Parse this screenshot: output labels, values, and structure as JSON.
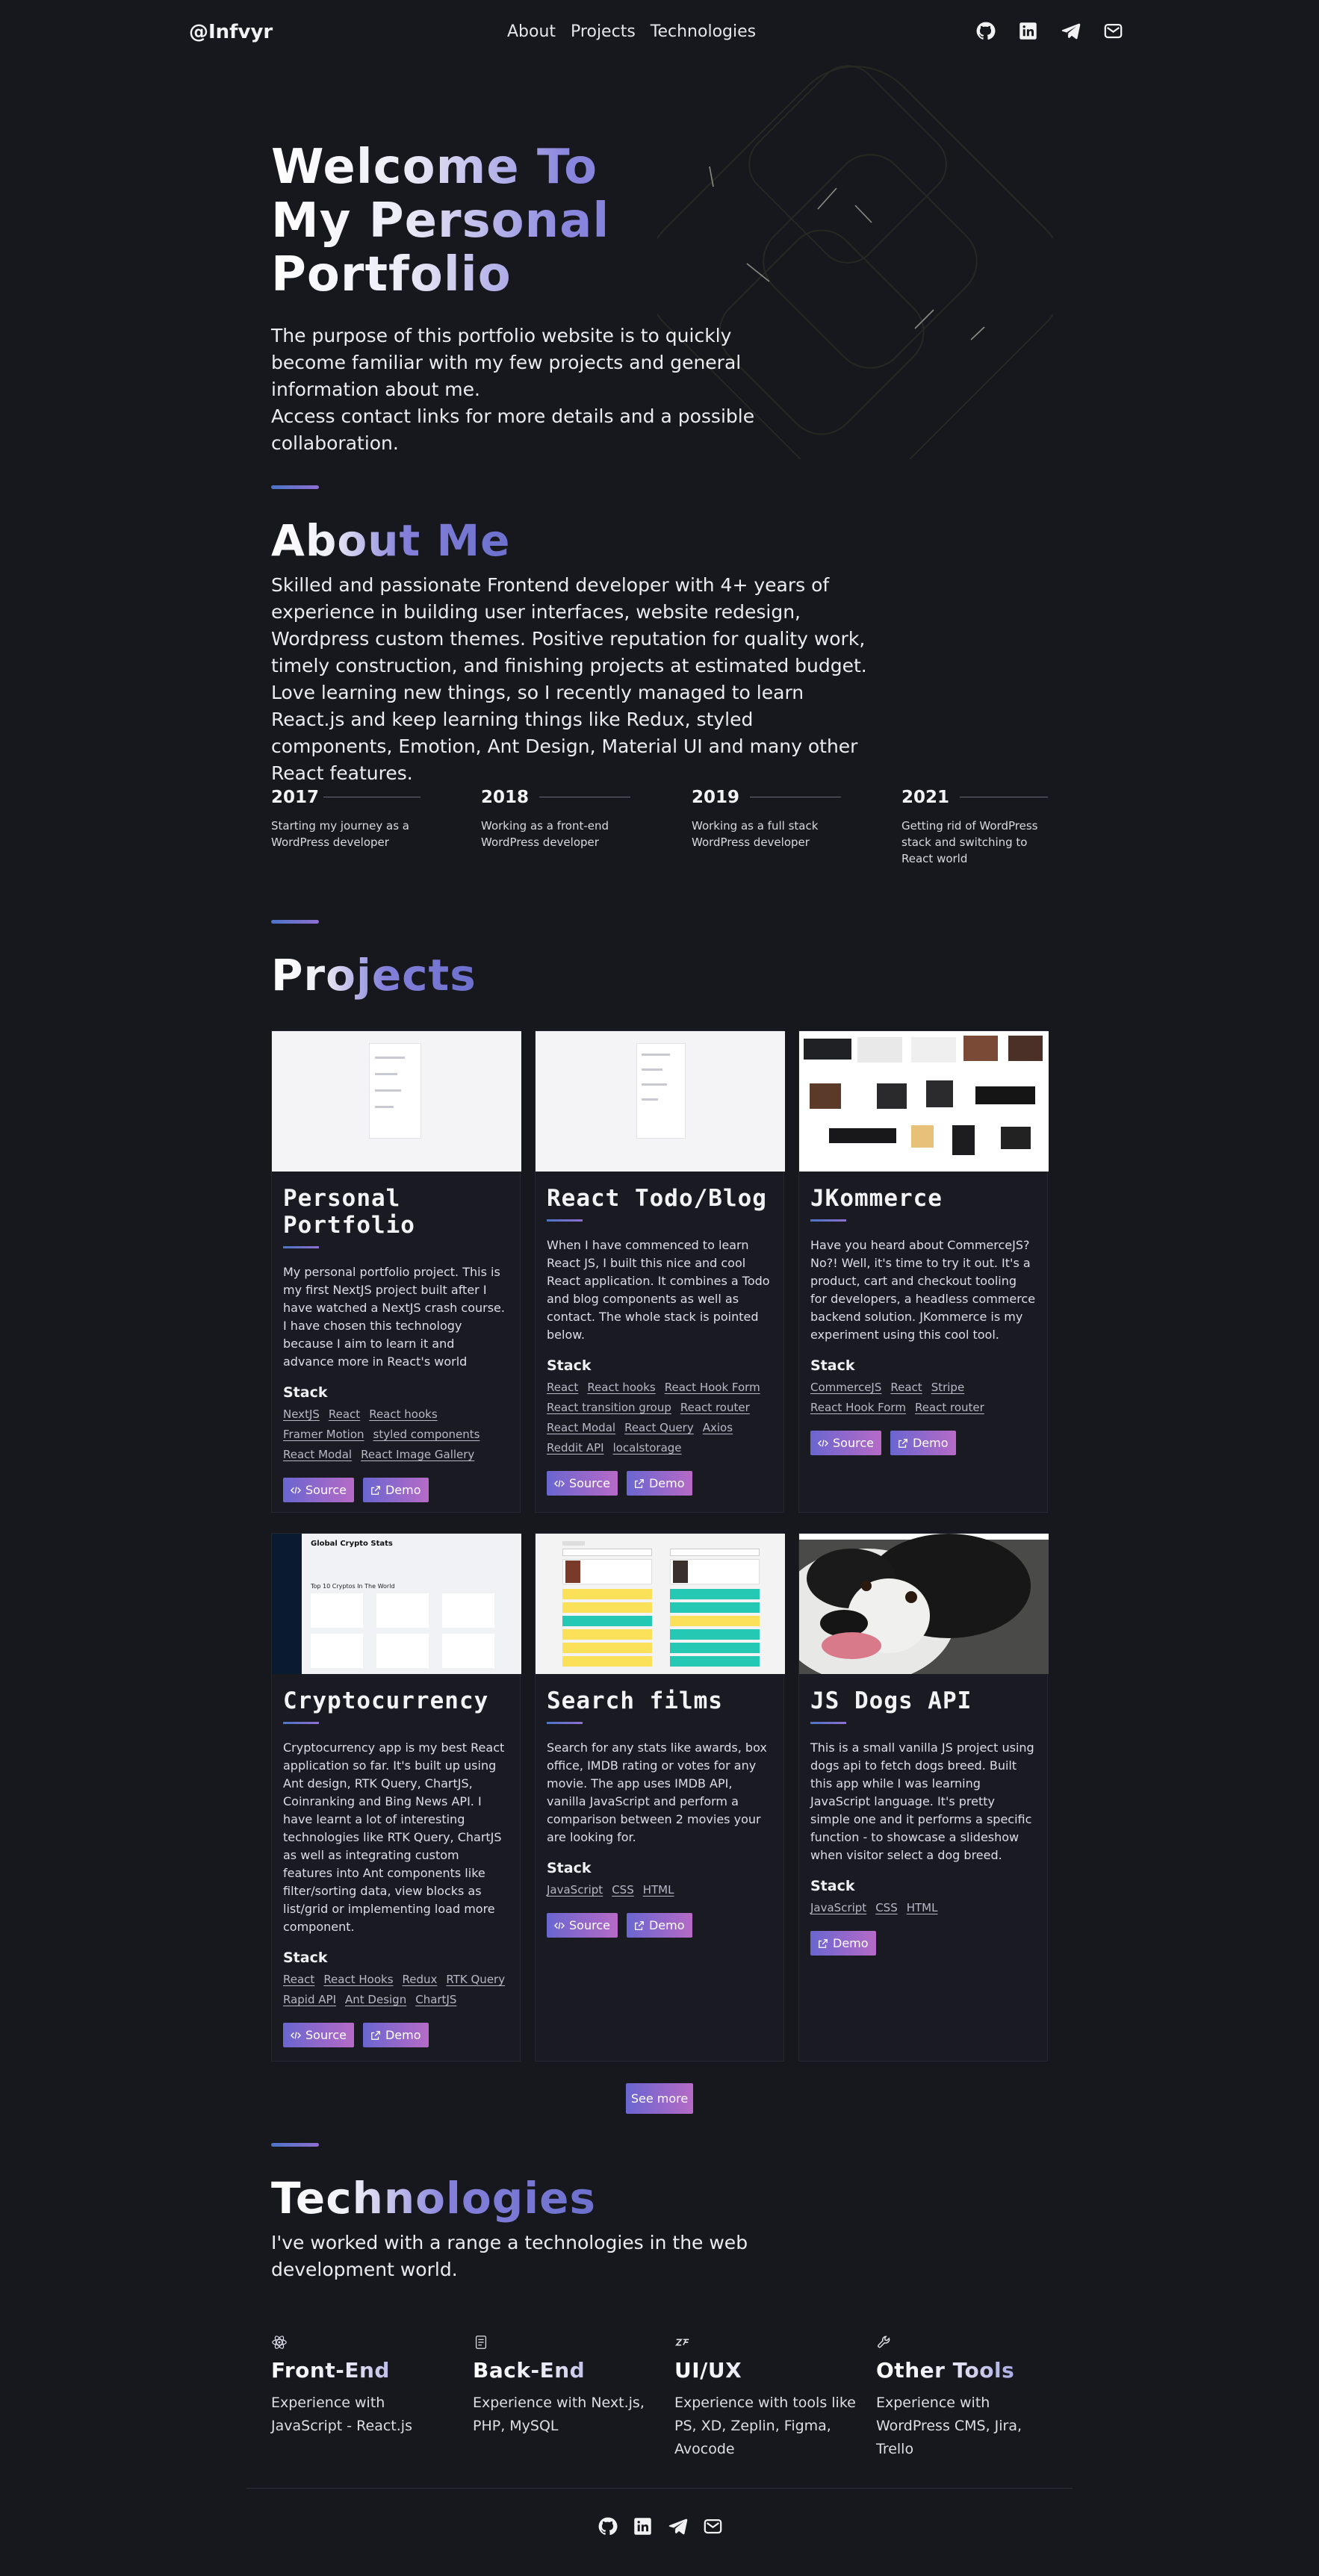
{
  "nav": {
    "logo": "@Infvyr",
    "links": [
      "About",
      "Projects",
      "Technologies"
    ],
    "social_icons": [
      "github-icon",
      "linkedin-icon",
      "telegram-icon",
      "mail-icon"
    ]
  },
  "hero": {
    "title_line1": "Welcome To",
    "title_line2": "My Personal Portfolio",
    "text": "The purpose of this portfolio website is to quickly become familiar with my few projects and general information about me.\nAccess contact links for more details and a possible collaboration."
  },
  "about": {
    "title": "About Me",
    "text": "Skilled and passionate Frontend developer with 4+ years of experience in building user interfaces, website redesign, Wordpress custom themes. Positive reputation for quality work, timely construction, and finishing projects at estimated budget. Love learning new things, so I recently managed to learn React.js and keep learning things like Redux, styled components, Emotion, Ant Design, Material UI and many other React features.",
    "timeline": [
      {
        "year": "2017",
        "desc": "Starting my journey as a WordPress developer"
      },
      {
        "year": "2018",
        "desc": "Working as a front-end WordPress developer"
      },
      {
        "year": "2019",
        "desc": "Working as a full stack WordPress developer"
      },
      {
        "year": "2021",
        "desc": "Getting rid of WordPress stack and switching to React world"
      }
    ]
  },
  "projects": {
    "title": "Projects",
    "stack_label": "Stack",
    "source_label": "Source",
    "demo_label": "Demo",
    "see_more": "See more",
    "items": [
      {
        "title": "Personal Portfolio",
        "desc": "My personal portfolio project. This is my first NextJS project built after I have watched a NextJS crash course. I have chosen this technology because I aim to learn it and advance more in React's world",
        "stack": [
          "NextJS",
          "React",
          "React hooks",
          "Framer Motion",
          "styled components",
          "React Modal",
          "React Image Gallery"
        ]
      },
      {
        "title": "React Todo/Blog",
        "desc": "When I have commenced to learn React JS, I built this nice and cool React application. It combines a Todo and blog components as well as contact. The whole stack is pointed below.",
        "stack": [
          "React",
          "React hooks",
          "React Hook Form",
          "React transition group",
          "React router",
          "React Modal",
          "React Query",
          "Axios",
          "Reddit API",
          "localstorage"
        ]
      },
      {
        "title": "JKommerce",
        "desc": "Have you heard about CommerceJS? No?! Well, it's time to try it out. It's a product, cart and checkout tooling for developers, a headless commerce backend solution. JKommerce is my experiment using this cool tool.",
        "stack": [
          "CommerceJS",
          "React",
          "Stripe",
          "React Hook Form",
          "React router"
        ]
      },
      {
        "title": "Cryptocurrency",
        "desc": "Cryptocurrency app is my best React application so far. It's built up using Ant design, RTK Query, ChartJS, Coinranking and Bing News API. I have learnt a lot of interesting technologies like RTK Query, ChartJS as well as integrating custom features into Ant components like filter/sorting data, view blocks as list/grid or implementing load more component.",
        "stack": [
          "React",
          "React Hooks",
          "Redux",
          "RTK Query",
          "Rapid API",
          "Ant Design",
          "ChartJS"
        ]
      },
      {
        "title": "Search films",
        "desc": "Search for any stats like awards, box office, IMDB rating or votes for any movie. The app uses IMDB API, vanilla JavaScript and perform a comparison between 2 movies your are looking for.",
        "stack": [
          "JavaScript",
          "CSS",
          "HTML"
        ]
      },
      {
        "title": "JS Dogs API",
        "desc": "This is a small vanilla JS project using dogs api to fetch dogs breed. Built this app while I was learning JavaScript language. It's pretty simple one and it performs a specific function - to showcase a slideshow when visitor select a dog breed.",
        "stack": [
          "JavaScript",
          "CSS",
          "HTML"
        ]
      }
    ],
    "thumb_texts": {
      "crypto": "Global Crypto Stats",
      "crypto_sub": "Top 10 Cryptos In The World"
    }
  },
  "technologies": {
    "title": "Technologies",
    "intro": "I've worked with a range a technologies in the web development world.",
    "items": [
      {
        "title": "Front-End",
        "desc": "Experience with JavaScript - React.js",
        "icon": "atom-icon"
      },
      {
        "title": "Back-End",
        "desc": "Experience with Next.js, PHP, MySQL",
        "icon": "server-icon"
      },
      {
        "title": "UI/UX",
        "desc": "Experience with tools like PS, XD, Zeplin, Figma, Avocode",
        "icon": "ux-icon"
      },
      {
        "title": "Other Tools",
        "desc": "Experience with WordPress CMS, Jira, Trello",
        "icon": "wrench-icon"
      }
    ]
  },
  "footer": {
    "social_icons": [
      "github-icon",
      "linkedin-icon",
      "telegram-icon",
      "mail-icon"
    ]
  }
}
